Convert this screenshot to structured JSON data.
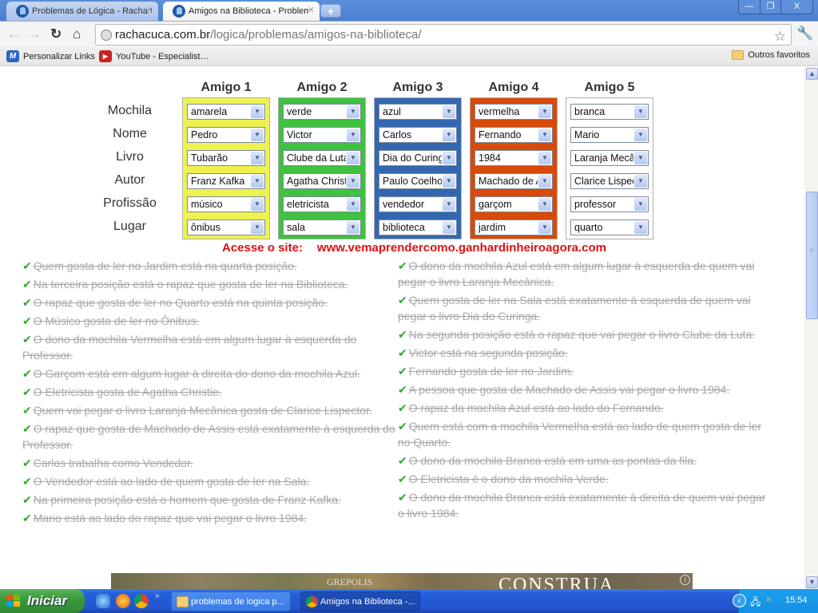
{
  "browser": {
    "tabs": [
      {
        "title": "Problemas de Lógica - Racha C",
        "active": false
      },
      {
        "title": "Amigos na Biblioteca - Problem",
        "active": true
      }
    ],
    "window_controls": {
      "minimize": "—",
      "restore": "❐",
      "close": "X"
    },
    "url_domain": "rachacuca.com.br",
    "url_path": "/logica/problemas/amigos-na-biblioteca/",
    "bookmarks": [
      {
        "label": "Personalizar Links",
        "icon": "M"
      },
      {
        "label": "YouTube - Especialist…",
        "icon": "▶"
      }
    ],
    "other_bookmarks": "Outros favoritos"
  },
  "puzzle": {
    "row_labels": [
      "Mochila",
      "Nome",
      "Livro",
      "Autor",
      "Profissão",
      "Lugar"
    ],
    "friends": [
      {
        "header": "Amigo 1",
        "color": "#eef250",
        "values": [
          "amarela",
          "Pedro",
          "Tubarão",
          "Franz Kafka",
          "músico",
          "ônibus"
        ]
      },
      {
        "header": "Amigo 2",
        "color": "#3fc23f",
        "values": [
          "verde",
          "Victor",
          "Clube da Luta",
          "Agatha Christie",
          "eletricista",
          "sala"
        ]
      },
      {
        "header": "Amigo 3",
        "color": "#3367b2",
        "values": [
          "azul",
          "Carlos",
          "Dia do Curinga",
          "Paulo Coelho",
          "vendedor",
          "biblioteca"
        ]
      },
      {
        "header": "Amigo 4",
        "color": "#d94a0a",
        "values": [
          "vermelha",
          "Fernando",
          "1984",
          "Machado de Assis",
          "garçom",
          "jardim"
        ]
      },
      {
        "header": "Amigo 5",
        "color": "#ffffff",
        "values": [
          "branca",
          "Mario",
          "Laranja Mecânica",
          "Clarice Lispector",
          "professor",
          "quarto"
        ]
      }
    ]
  },
  "promo": {
    "label": "Acesse o site:",
    "site": "www.vemaprendercomo.ganhardinheiroagora.com"
  },
  "clues_left": [
    "Quem gosta de ler no Jardim está na quarta posição.",
    "Na terceira posição está o rapaz que gosta de ler na Biblioteca.",
    "O rapaz que gosta de ler no Quarto está na quinta posição.",
    "O Músico gosta de ler no Ônibus.",
    "O dono da mochila Vermelha está em algum lugar à esquerda do Professor.",
    "O Garçom está em algum lugar à direita do dono da mochila Azul.",
    "O Eletricista gosta de Agatha Christie.",
    "Quem vai pegar o livro Laranja Mecânica gosta de Clarice Lispector.",
    "O rapaz que gosta de Machado de Assis está exatamente à esquerda do Professor.",
    "Carlos trabalha como Vendedor.",
    "O Vendedor está ao lado de quem gosta de ler na Sala.",
    "Na primeira posição está o homem que gosta de Franz Kafka.",
    "Mario está ao lado do rapaz que vai pegar o livro 1984."
  ],
  "clues_right": [
    "O dono da mochila Azul está em algum lugar à esquerda de quem vai pegar o livro Laranja Mecânica.",
    "Quem gosta de ler na Sala está exatamente à esquerda de quem vai pegar o livro Dia do Curinga.",
    "Na segunda posição está o rapaz que vai pegar o livro Clube da Luta.",
    "Victor está na segunda posição.",
    "Fernando gosta de ler no Jardim.",
    "A pessoa que gosta de Machado de Assis vai pegar o livro 1984.",
    "O rapaz da mochila Azul está ao lado do Fernando.",
    "Quem está com a mochila Vermelha está ao lado de quem gosta de ler no Quarto.",
    "O dono da mochila Branca está em uma as pontas da fila.",
    "O Eletricista é o dono da mochila Verde.",
    "O dono da mochila Branca está exatamente à direita de quem vai pegar o livro 1984."
  ],
  "ad": {
    "title": "CONSTRUA",
    "subtitle": "GREPOLIS",
    "info": "i"
  },
  "taskbar": {
    "start_label": "Iniciar",
    "tasks": [
      {
        "label": "problemas de logica p...",
        "icon": "folder-icon",
        "active": false
      },
      {
        "label": "Amigos na Biblioteca -...",
        "icon": "chrome-icon",
        "active": true
      }
    ],
    "clock": "15:54"
  }
}
